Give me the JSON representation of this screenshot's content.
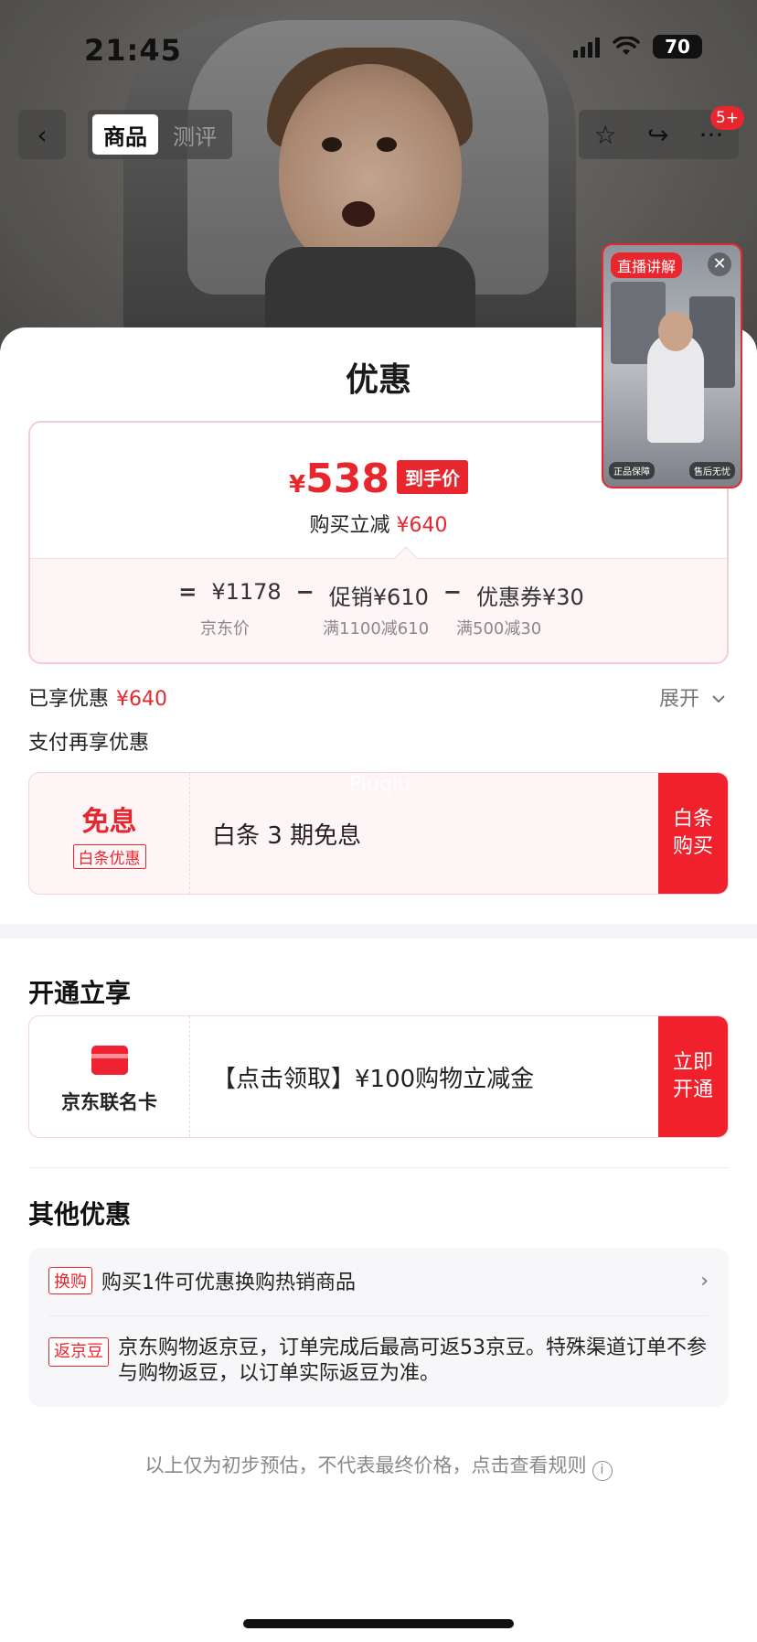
{
  "status_bar": {
    "time": "21:45",
    "battery": "70"
  },
  "nav": {
    "back_icon": "‹",
    "tabs": [
      "商品",
      "测评"
    ],
    "notif_count": "5+"
  },
  "live": {
    "tag": "直播讲解",
    "badge_left": "正品保障",
    "badge_right": "售后无忧"
  },
  "sheet": {
    "title": "优惠",
    "price": {
      "currency": "¥",
      "final": "538",
      "final_tag": "到手价",
      "reduce_label": "购买立减",
      "reduce_value": "¥640",
      "formula": {
        "eq": "=",
        "jd_price": "¥1178",
        "minus1": "−",
        "promo": "促销¥610",
        "minus2": "−",
        "coupon": "优惠券¥30",
        "jd_price_label": "京东价",
        "promo_label": "满1100减610",
        "coupon_label": "满500减30"
      }
    },
    "enjoyed_label": "已享优惠",
    "enjoyed_value": "¥640",
    "expand_label": "展开",
    "pay_more_label": "支付再享优惠",
    "baitiao": {
      "title": "免息",
      "tag": "白条优惠",
      "desc": "白条 3 期免息",
      "button": "白条\n购买",
      "watermark": "Piuqiu"
    },
    "open_title": "开通立享",
    "jdcard": {
      "name": "京东联名卡",
      "desc": "【点击领取】¥100购物立减金",
      "button": "立即\n开通"
    },
    "other_title": "其他优惠",
    "other": [
      {
        "chip": "换购",
        "text": "购买1件可优惠换购热销商品"
      },
      {
        "chip": "返京豆",
        "text": "京东购物返京豆，订单完成后最高可返53京豆。特殊渠道订单不参与购物返豆，以订单实际返豆为准。"
      }
    ],
    "disclaimer": "以上仅为初步预估，不代表最终价格，点击查看规则"
  },
  "colors": {
    "accent": "#e8262d",
    "button_red": "#f0212d"
  }
}
